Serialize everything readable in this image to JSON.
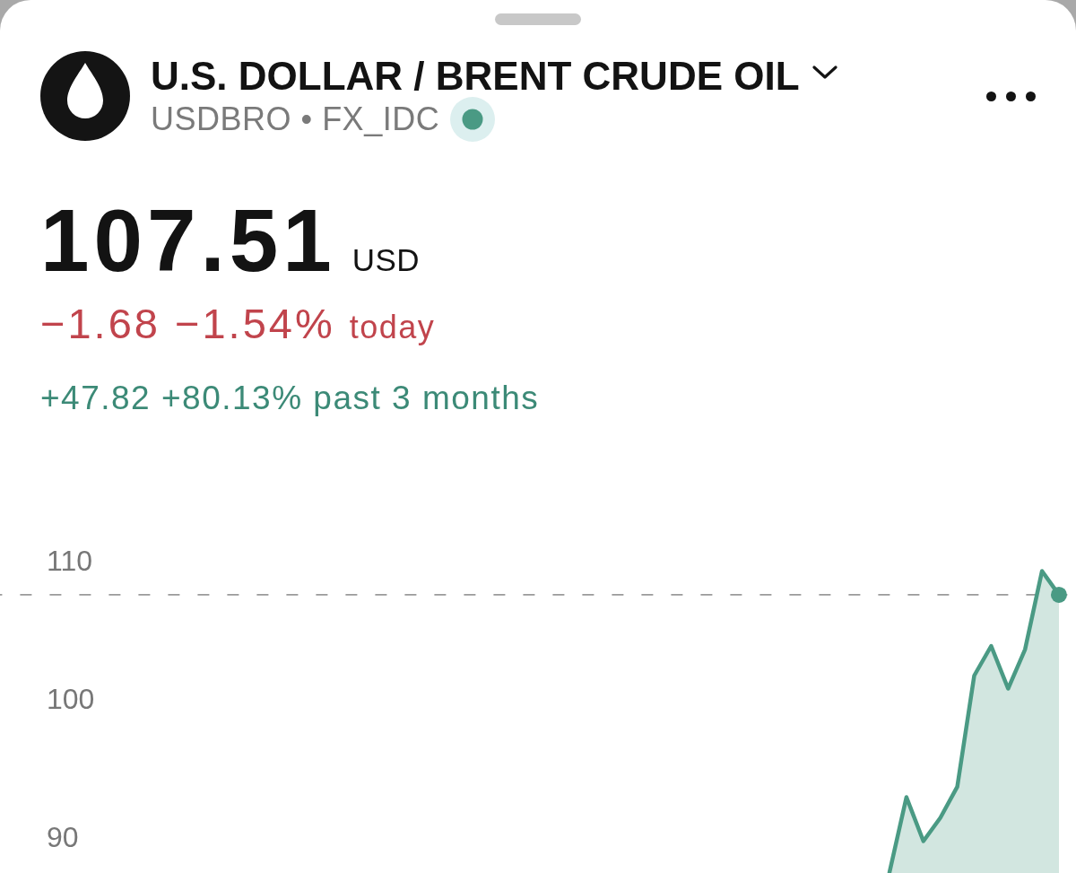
{
  "header": {
    "title": "U.S. DOLLAR / BRENT CRUDE OIL",
    "subtitle": "USDBRO • FX_IDC",
    "market_open": true
  },
  "quote": {
    "price": "107.51",
    "currency": "USD",
    "change_today": {
      "value": "−1.68 −1.54%",
      "period": "today",
      "negative": true
    },
    "change_period": {
      "value": "+47.82 +80.13%",
      "period": "past 3 months",
      "negative": false
    }
  },
  "chart": {
    "chart_data": {
      "type": "area",
      "categories": [
        null,
        null,
        null,
        null,
        null,
        null,
        null,
        null,
        null,
        null,
        null,
        null,
        null,
        null,
        null,
        null,
        null,
        null,
        null,
        null,
        null,
        null,
        null,
        null,
        null,
        null,
        null,
        null,
        null,
        null,
        null,
        null,
        null,
        null,
        null,
        null,
        null,
        null,
        null,
        null,
        null,
        null,
        null,
        null,
        null,
        null,
        null,
        null,
        null,
        null,
        null,
        null,
        null,
        null,
        null,
        null,
        null,
        null,
        null,
        null,
        null,
        null,
        null
      ],
      "ylim": [
        87.4,
        150.5
      ],
      "yticks": [
        {
          "value": 90,
          "label": "90"
        },
        {
          "value": 100,
          "label": "100"
        },
        {
          "value": 110,
          "label": "110"
        }
      ],
      "values": [
        null,
        null,
        null,
        null,
        null,
        null,
        null,
        null,
        null,
        null,
        null,
        null,
        null,
        null,
        null,
        null,
        null,
        null,
        null,
        null,
        null,
        null,
        null,
        null,
        null,
        null,
        null,
        null,
        null,
        null,
        null,
        null,
        null,
        null,
        null,
        null,
        null,
        null,
        null,
        null,
        null,
        null,
        null,
        null,
        null,
        null,
        null,
        null,
        null,
        null,
        null,
        null,
        87.45,
        92.88,
        89.7,
        91.39,
        93.63,
        101.67,
        103.81,
        100.73,
        103.56,
        109.22,
        107.51
      ],
      "ref_lines": [
        {
          "axis": "y",
          "value": 107.51
        }
      ]
    }
  }
}
